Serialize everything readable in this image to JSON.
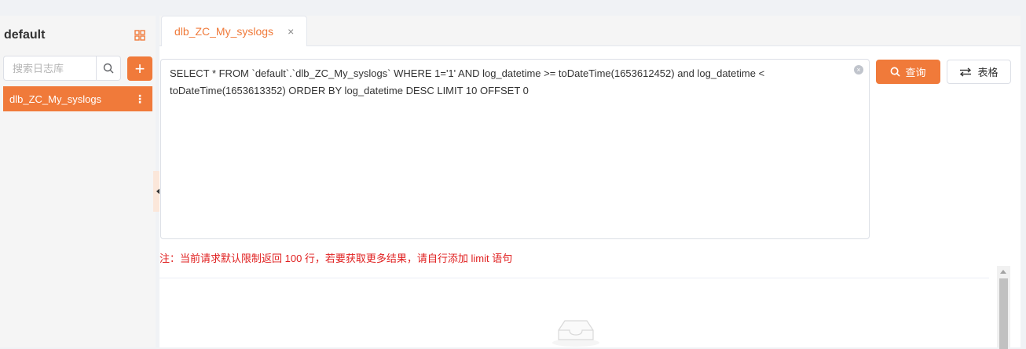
{
  "sidebar": {
    "title": "default",
    "grid_icon": "grid-icon",
    "search": {
      "placeholder": "搜索日志库",
      "value": ""
    },
    "add_label": "+",
    "items": [
      {
        "label": "dlb_ZC_My_syslogs",
        "menu_icon": "⋮"
      }
    ]
  },
  "tabs": [
    {
      "label": "dlb_ZC_My_syslogs",
      "close": "×",
      "active": true
    }
  ],
  "editor": {
    "sql": "SELECT * FROM `default`.`dlb_ZC_My_syslogs` WHERE 1='1' AND log_datetime >= toDateTime(1653612452) and log_datetime < toDateTime(1653613352) ORDER BY log_datetime DESC LIMIT 10 OFFSET 0",
    "clear_icon": "×"
  },
  "toolbar": {
    "query_label": "查询",
    "table_label": "表格"
  },
  "note": "注：当前请求默认限制返回 100 行，若要获取更多结果，请自行添加 limit 语句",
  "colors": {
    "accent": "#f07a3a",
    "note": "#e02020"
  }
}
